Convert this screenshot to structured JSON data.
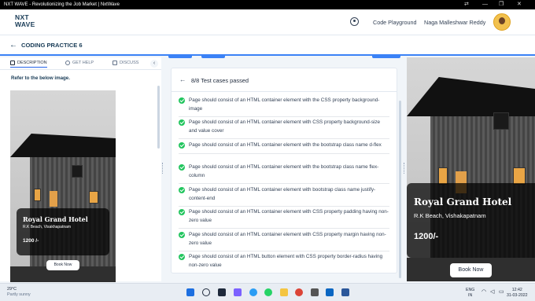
{
  "window": {
    "title": "NXT WAVE - Revolutionizing the Job Market | NxtWave",
    "controls": [
      "⇄",
      "—",
      "❐",
      "✕"
    ]
  },
  "topnav": {
    "logo_line1": "NXT",
    "logo_line2": "WAVE",
    "playground": "Code Playground",
    "user_name": "Naga Malleshwar Reddy"
  },
  "subnav": {
    "back": "←",
    "page_title": "CODING PRACTICE 6"
  },
  "left_panel": {
    "tabs": [
      {
        "label": "DESCRIPTION"
      },
      {
        "label": "GET HELP"
      },
      {
        "label": "DISCUSS"
      }
    ],
    "collapse": "‹",
    "instruction": "Refer to the below image.",
    "preview": {
      "hotel_name": "Royal Grand Hotel",
      "location": "R.K Beach, Visakhapatnam",
      "price": "1200 /-",
      "button": "Book Now"
    }
  },
  "results": {
    "back": "←",
    "title": "8/8 Test cases passed",
    "cases": [
      "Page should consist of an HTML container element with the CSS property background-image",
      "Page should consist of an HTML container element with CSS property background-size and value cover",
      "Page should consist of an HTML container element with the bootstrap class name d-flex",
      "Page should consist of an HTML container element with the bootstrap class name flex-column",
      "Page should consist of an HTML container element with bootstrap class name justify-content-end",
      "Page should consist of an HTML container element with CSS property padding having non-zero value",
      "Page should consist of an HTML container element with CSS property margin having non-zero value",
      "Page should consist of an HTML button element with CSS property border-radius having non-zero value"
    ]
  },
  "right_preview": {
    "hotel_name": "Royal Grand Hotel",
    "location": "R.K Beach, Vishakapatnam",
    "price": "1200/-",
    "button": "Book Now"
  },
  "taskbar": {
    "temp": "29°C",
    "weather": "Partly sunny",
    "lang1": "ENG",
    "lang2": "IN",
    "time": "12:42",
    "date": "31-03-2022",
    "icons": [
      "windows-icon",
      "search-icon",
      "file-explorer-icon",
      "teams-icon",
      "store-icon",
      "edge-icon",
      "whatsapp-icon",
      "chrome-icon",
      "mail-icon",
      "vscode-icon",
      "word-icon"
    ]
  },
  "colors": {
    "accent": "#2563eb",
    "success": "#22c55e",
    "heading": "#183b56"
  }
}
